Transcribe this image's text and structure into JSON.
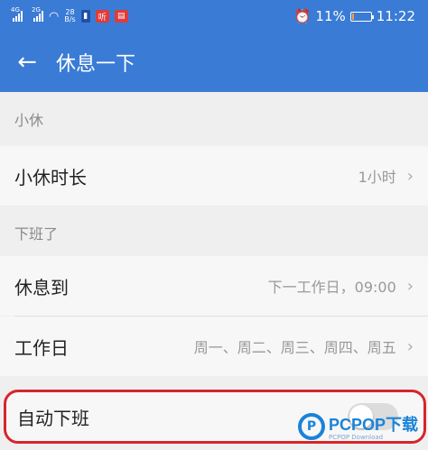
{
  "status_bar": {
    "sig1_tag": "4G",
    "sig2_tag": "2G",
    "speed_value": "28",
    "speed_unit": "B/s",
    "app_badge_1": "听",
    "app_badge_2": "▤",
    "battery_percent": "11%",
    "time": "11:22",
    "battery_level": 0.11,
    "battery_color": "#ff9a3d"
  },
  "app_bar": {
    "title": "休息一下",
    "color": "#3a7bd5"
  },
  "sections": {
    "short_break": {
      "header": "小休",
      "rows": [
        {
          "label": "小休时长",
          "value": "1小时"
        }
      ]
    },
    "off_work": {
      "header": "下班了",
      "rows": [
        {
          "label": "休息到",
          "value": "下一工作日，09:00"
        },
        {
          "label": "工作日",
          "value": "周一、周二、周三、周四、周五"
        }
      ]
    }
  },
  "auto_off": {
    "label": "自动下班",
    "enabled": false,
    "highlight_color": "#d7252b"
  },
  "watermark": {
    "logo_letter": "P",
    "main": "PCPOP下载",
    "sub": "PCPOP Download"
  }
}
